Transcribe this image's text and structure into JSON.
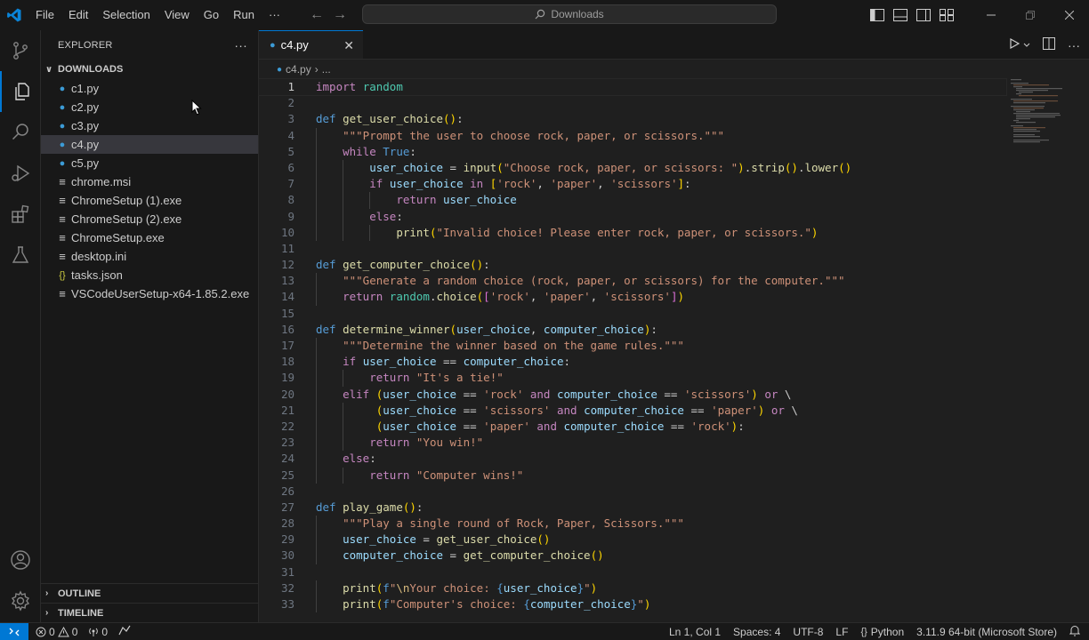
{
  "titlebar": {
    "menu": [
      "File",
      "Edit",
      "Selection",
      "View",
      "Go",
      "Run",
      "···"
    ],
    "search_placeholder": "Downloads"
  },
  "activity": [
    "source-control",
    "explorer",
    "search",
    "run-debug",
    "extensions",
    "testing",
    "accounts",
    "manage"
  ],
  "sidebar": {
    "title": "EXPLORER",
    "more": "···",
    "folder": "DOWNLOADS",
    "files": [
      {
        "name": "c1.py",
        "icon": "python-icon"
      },
      {
        "name": "c2.py",
        "icon": "python-icon"
      },
      {
        "name": "c3.py",
        "icon": "python-icon"
      },
      {
        "name": "c4.py",
        "icon": "python-icon",
        "selected": true
      },
      {
        "name": "c5.py",
        "icon": "python-icon"
      },
      {
        "name": "chrome.msi",
        "icon": "file-icon"
      },
      {
        "name": "ChromeSetup (1).exe",
        "icon": "file-icon"
      },
      {
        "name": "ChromeSetup (2).exe",
        "icon": "file-icon"
      },
      {
        "name": "ChromeSetup.exe",
        "icon": "file-icon"
      },
      {
        "name": "desktop.ini",
        "icon": "file-icon"
      },
      {
        "name": "tasks.json",
        "icon": "json-icon"
      },
      {
        "name": "VSCodeUserSetup-x64-1.85.2.exe",
        "icon": "file-icon"
      }
    ],
    "outline": "OUTLINE",
    "timeline": "TIMELINE"
  },
  "editor": {
    "tab": "c4.py",
    "breadcrumb_file": "c4.py",
    "breadcrumb_more": "...",
    "lines": [
      "import random",
      "",
      "def get_user_choice():",
      "    \"\"\"Prompt the user to choose rock, paper, or scissors.\"\"\"",
      "    while True:",
      "        user_choice = input(\"Choose rock, paper, or scissors: \").strip().lower()",
      "        if user_choice in ['rock', 'paper', 'scissors']:",
      "            return user_choice",
      "        else:",
      "            print(\"Invalid choice! Please enter rock, paper, or scissors.\")",
      "",
      "def get_computer_choice():",
      "    \"\"\"Generate a random choice (rock, paper, or scissors) for the computer.\"\"\"",
      "    return random.choice(['rock', 'paper', 'scissors'])",
      "",
      "def determine_winner(user_choice, computer_choice):",
      "    \"\"\"Determine the winner based on the game rules.\"\"\"",
      "    if user_choice == computer_choice:",
      "        return \"It's a tie!\"",
      "    elif (user_choice == 'rock' and computer_choice == 'scissors') or \\",
      "         (user_choice == 'scissors' and computer_choice == 'paper') or \\",
      "         (user_choice == 'paper' and computer_choice == 'rock'):",
      "        return \"You win!\"",
      "    else:",
      "        return \"Computer wins!\"",
      "",
      "def play_game():",
      "    \"\"\"Play a single round of Rock, Paper, Scissors.\"\"\"",
      "    user_choice = get_user_choice()",
      "    computer_choice = get_computer_choice()",
      "",
      "    print(f\"\\nYour choice: {user_choice}\")",
      "    print(f\"Computer's choice: {computer_choice}\")"
    ],
    "current_line": 1
  },
  "statusbar": {
    "errors": "0",
    "warnings": "0",
    "ports": "0",
    "position": "Ln 1, Col 1",
    "spaces": "Spaces: 4",
    "encoding": "UTF-8",
    "eol": "LF",
    "language": "Python",
    "interpreter": "3.11.9 64-bit (Microsoft Store)"
  },
  "colors": {
    "accent": "#0078d4",
    "keyword": "#c586c0",
    "def": "#569cd6",
    "function": "#dcdcaa",
    "variable": "#9cdcfe",
    "string": "#ce9178",
    "python_icon": "#3c9bd6"
  }
}
